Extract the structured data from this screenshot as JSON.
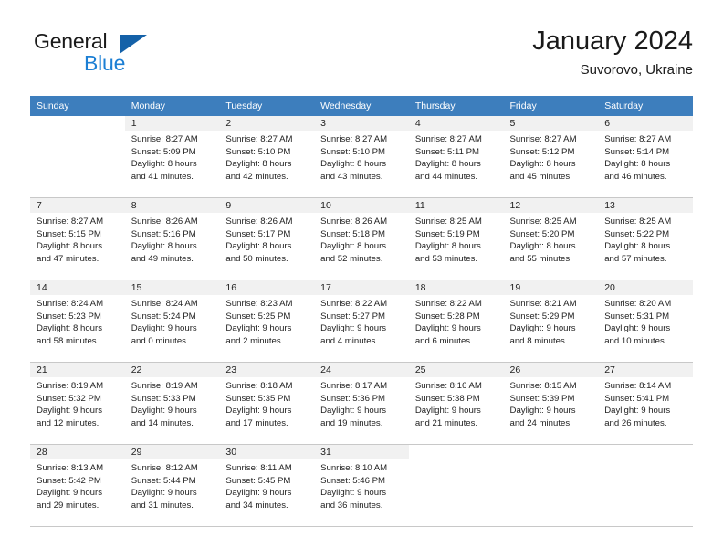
{
  "brand": {
    "word1": "General",
    "word2": "Blue",
    "triangle_color": "#1461a8",
    "blue_color": "#1c7fd4"
  },
  "header": {
    "title": "January 2024",
    "location": "Suvorovo, Ukraine"
  },
  "theme": {
    "header_row_bg": "#3d7ebd",
    "daynum_bg": "#f1f1f1",
    "grid_line": "#c8c8c8"
  },
  "weekdays": [
    "Sunday",
    "Monday",
    "Tuesday",
    "Wednesday",
    "Thursday",
    "Friday",
    "Saturday"
  ],
  "weeks": [
    [
      {
        "day": "",
        "blank": true,
        "l1": "",
        "l2": "",
        "l3": "",
        "l4": ""
      },
      {
        "day": "1",
        "l1": "Sunrise: 8:27 AM",
        "l2": "Sunset: 5:09 PM",
        "l3": "Daylight: 8 hours",
        "l4": "and 41 minutes."
      },
      {
        "day": "2",
        "l1": "Sunrise: 8:27 AM",
        "l2": "Sunset: 5:10 PM",
        "l3": "Daylight: 8 hours",
        "l4": "and 42 minutes."
      },
      {
        "day": "3",
        "l1": "Sunrise: 8:27 AM",
        "l2": "Sunset: 5:10 PM",
        "l3": "Daylight: 8 hours",
        "l4": "and 43 minutes."
      },
      {
        "day": "4",
        "l1": "Sunrise: 8:27 AM",
        "l2": "Sunset: 5:11 PM",
        "l3": "Daylight: 8 hours",
        "l4": "and 44 minutes."
      },
      {
        "day": "5",
        "l1": "Sunrise: 8:27 AM",
        "l2": "Sunset: 5:12 PM",
        "l3": "Daylight: 8 hours",
        "l4": "and 45 minutes."
      },
      {
        "day": "6",
        "l1": "Sunrise: 8:27 AM",
        "l2": "Sunset: 5:14 PM",
        "l3": "Daylight: 8 hours",
        "l4": "and 46 minutes."
      }
    ],
    [
      {
        "day": "7",
        "l1": "Sunrise: 8:27 AM",
        "l2": "Sunset: 5:15 PM",
        "l3": "Daylight: 8 hours",
        "l4": "and 47 minutes."
      },
      {
        "day": "8",
        "l1": "Sunrise: 8:26 AM",
        "l2": "Sunset: 5:16 PM",
        "l3": "Daylight: 8 hours",
        "l4": "and 49 minutes."
      },
      {
        "day": "9",
        "l1": "Sunrise: 8:26 AM",
        "l2": "Sunset: 5:17 PM",
        "l3": "Daylight: 8 hours",
        "l4": "and 50 minutes."
      },
      {
        "day": "10",
        "l1": "Sunrise: 8:26 AM",
        "l2": "Sunset: 5:18 PM",
        "l3": "Daylight: 8 hours",
        "l4": "and 52 minutes."
      },
      {
        "day": "11",
        "l1": "Sunrise: 8:25 AM",
        "l2": "Sunset: 5:19 PM",
        "l3": "Daylight: 8 hours",
        "l4": "and 53 minutes."
      },
      {
        "day": "12",
        "l1": "Sunrise: 8:25 AM",
        "l2": "Sunset: 5:20 PM",
        "l3": "Daylight: 8 hours",
        "l4": "and 55 minutes."
      },
      {
        "day": "13",
        "l1": "Sunrise: 8:25 AM",
        "l2": "Sunset: 5:22 PM",
        "l3": "Daylight: 8 hours",
        "l4": "and 57 minutes."
      }
    ],
    [
      {
        "day": "14",
        "l1": "Sunrise: 8:24 AM",
        "l2": "Sunset: 5:23 PM",
        "l3": "Daylight: 8 hours",
        "l4": "and 58 minutes."
      },
      {
        "day": "15",
        "l1": "Sunrise: 8:24 AM",
        "l2": "Sunset: 5:24 PM",
        "l3": "Daylight: 9 hours",
        "l4": "and 0 minutes."
      },
      {
        "day": "16",
        "l1": "Sunrise: 8:23 AM",
        "l2": "Sunset: 5:25 PM",
        "l3": "Daylight: 9 hours",
        "l4": "and 2 minutes."
      },
      {
        "day": "17",
        "l1": "Sunrise: 8:22 AM",
        "l2": "Sunset: 5:27 PM",
        "l3": "Daylight: 9 hours",
        "l4": "and 4 minutes."
      },
      {
        "day": "18",
        "l1": "Sunrise: 8:22 AM",
        "l2": "Sunset: 5:28 PM",
        "l3": "Daylight: 9 hours",
        "l4": "and 6 minutes."
      },
      {
        "day": "19",
        "l1": "Sunrise: 8:21 AM",
        "l2": "Sunset: 5:29 PM",
        "l3": "Daylight: 9 hours",
        "l4": "and 8 minutes."
      },
      {
        "day": "20",
        "l1": "Sunrise: 8:20 AM",
        "l2": "Sunset: 5:31 PM",
        "l3": "Daylight: 9 hours",
        "l4": "and 10 minutes."
      }
    ],
    [
      {
        "day": "21",
        "l1": "Sunrise: 8:19 AM",
        "l2": "Sunset: 5:32 PM",
        "l3": "Daylight: 9 hours",
        "l4": "and 12 minutes."
      },
      {
        "day": "22",
        "l1": "Sunrise: 8:19 AM",
        "l2": "Sunset: 5:33 PM",
        "l3": "Daylight: 9 hours",
        "l4": "and 14 minutes."
      },
      {
        "day": "23",
        "l1": "Sunrise: 8:18 AM",
        "l2": "Sunset: 5:35 PM",
        "l3": "Daylight: 9 hours",
        "l4": "and 17 minutes."
      },
      {
        "day": "24",
        "l1": "Sunrise: 8:17 AM",
        "l2": "Sunset: 5:36 PM",
        "l3": "Daylight: 9 hours",
        "l4": "and 19 minutes."
      },
      {
        "day": "25",
        "l1": "Sunrise: 8:16 AM",
        "l2": "Sunset: 5:38 PM",
        "l3": "Daylight: 9 hours",
        "l4": "and 21 minutes."
      },
      {
        "day": "26",
        "l1": "Sunrise: 8:15 AM",
        "l2": "Sunset: 5:39 PM",
        "l3": "Daylight: 9 hours",
        "l4": "and 24 minutes."
      },
      {
        "day": "27",
        "l1": "Sunrise: 8:14 AM",
        "l2": "Sunset: 5:41 PM",
        "l3": "Daylight: 9 hours",
        "l4": "and 26 minutes."
      }
    ],
    [
      {
        "day": "28",
        "l1": "Sunrise: 8:13 AM",
        "l2": "Sunset: 5:42 PM",
        "l3": "Daylight: 9 hours",
        "l4": "and 29 minutes."
      },
      {
        "day": "29",
        "l1": "Sunrise: 8:12 AM",
        "l2": "Sunset: 5:44 PM",
        "l3": "Daylight: 9 hours",
        "l4": "and 31 minutes."
      },
      {
        "day": "30",
        "l1": "Sunrise: 8:11 AM",
        "l2": "Sunset: 5:45 PM",
        "l3": "Daylight: 9 hours",
        "l4": "and 34 minutes."
      },
      {
        "day": "31",
        "l1": "Sunrise: 8:10 AM",
        "l2": "Sunset: 5:46 PM",
        "l3": "Daylight: 9 hours",
        "l4": "and 36 minutes."
      },
      {
        "day": "",
        "blank": true,
        "l1": "",
        "l2": "",
        "l3": "",
        "l4": ""
      },
      {
        "day": "",
        "blank": true,
        "l1": "",
        "l2": "",
        "l3": "",
        "l4": ""
      },
      {
        "day": "",
        "blank": true,
        "l1": "",
        "l2": "",
        "l3": "",
        "l4": ""
      }
    ]
  ]
}
